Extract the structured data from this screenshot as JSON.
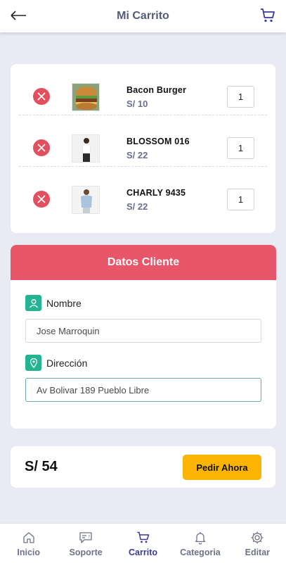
{
  "header": {
    "title": "Mi Carrito",
    "back_icon": "arrow-left-icon",
    "cart_icon": "shopping-cart-icon"
  },
  "cart": {
    "items": [
      {
        "name": "Bacon Burger",
        "price": "S/ 10",
        "qty": "1",
        "image": "burger-image"
      },
      {
        "name": "BLOSSOM 016",
        "price": "S/ 22",
        "qty": "1",
        "image": "blossom-outfit-image"
      },
      {
        "name": "CHARLY 9435",
        "price": "S/ 22",
        "qty": "1",
        "image": "charly-outfit-image"
      }
    ]
  },
  "client": {
    "title": "Datos Cliente",
    "name_label": "Nombre",
    "name_value": "Jose Marroquin",
    "address_label": "Dirección",
    "address_value": "Av Bolivar 189 Pueblo Libre"
  },
  "footer": {
    "total": "S/ 54",
    "order_label": "Pedir Ahora"
  },
  "nav": [
    {
      "label": "Inicio",
      "icon": "home-icon",
      "active": false
    },
    {
      "label": "Soporte",
      "icon": "support-chat-icon",
      "active": false
    },
    {
      "label": "Carrito",
      "icon": "cart-icon",
      "active": true
    },
    {
      "label": "Categoria",
      "icon": "bell-icon",
      "active": false
    },
    {
      "label": "Editar",
      "icon": "gear-icon",
      "active": false
    }
  ],
  "colors": {
    "accent_red": "#e8566a",
    "remove_red": "#e2505f",
    "field_icon_green": "#25b491",
    "button_yellow": "#fbb401",
    "nav_active": "#3a3a93"
  }
}
